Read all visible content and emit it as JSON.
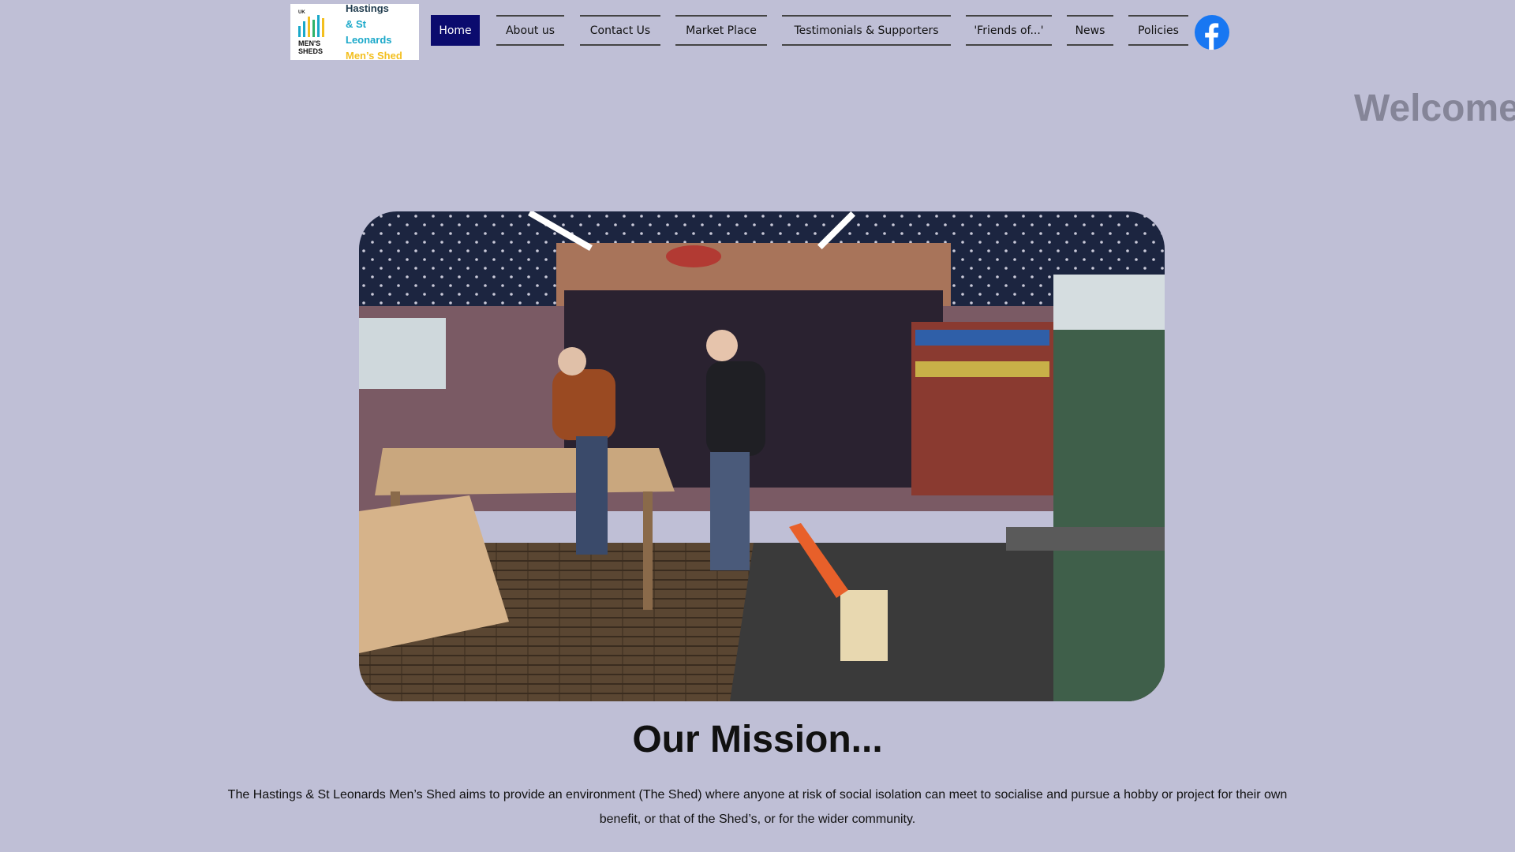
{
  "logo": {
    "uk": "UK",
    "mark_text_line1": "MEN'S",
    "mark_text_line2": "SHEDS",
    "line1": "Hastings",
    "line2": "& St Leonards",
    "line3": "Men’s Shed",
    "colors": {
      "dark": "#1f3b4d",
      "teal": "#1aa8c9",
      "yellow": "#f3bf1f"
    }
  },
  "nav": {
    "items": [
      {
        "label": "Home",
        "active": true
      },
      {
        "label": "About us"
      },
      {
        "label": "Contact Us"
      },
      {
        "label": "Market Place"
      },
      {
        "label": "Testimonials & Supporters"
      },
      {
        "label": "'Friends of...'"
      },
      {
        "label": "News"
      },
      {
        "label": "Policies"
      }
    ],
    "active_color": "#0b0b6e"
  },
  "social": {
    "icon": "facebook-icon",
    "color": "#1877f2"
  },
  "welcome": "Welcome",
  "hero": {
    "icon": "workshop-photo"
  },
  "mission": {
    "title": "Our Mission...",
    "text": "The Hastings & St Leonards Men’s Shed aims to provide an environment (The Shed) where anyone at risk of social isolation can meet to socialise and pursue a hobby or project for their own benefit, or that of the Shed’s, or for the wider community."
  },
  "colors": {
    "background": "#bfbfd6",
    "welcome_text": "#858598"
  }
}
